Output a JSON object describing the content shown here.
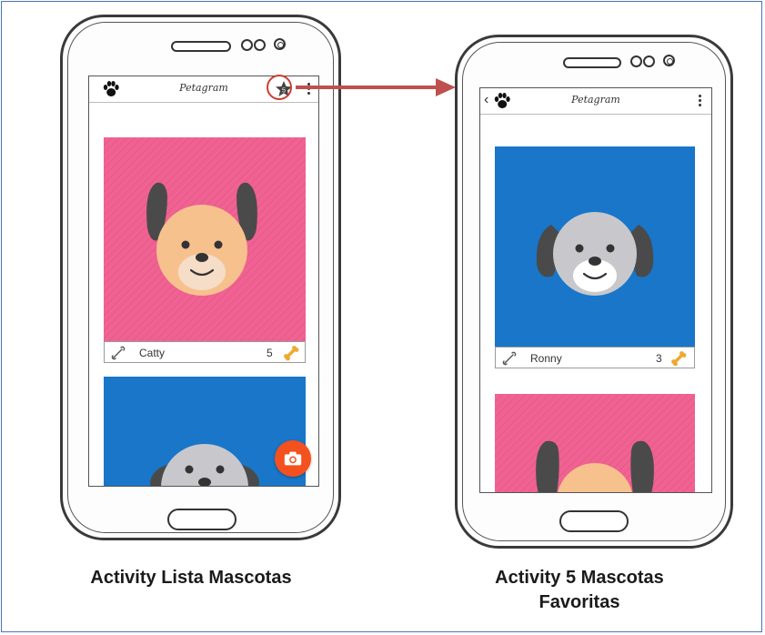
{
  "left_screen": {
    "app_title": "Petagram",
    "pets": [
      {
        "name": "Catty",
        "likes": "5",
        "bg_color": "#f06292"
      },
      {
        "name": "",
        "likes": "",
        "bg_color": "#1976c9"
      }
    ],
    "actions": {
      "favorites_icon": "star-icon",
      "fab_icon": "camera-icon"
    }
  },
  "right_screen": {
    "app_title": "Petagram",
    "back_glyph": "‹",
    "pets": [
      {
        "name": "Ronny",
        "likes": "3",
        "bg_color": "#1976c9"
      },
      {
        "name": "",
        "likes": "",
        "bg_color": "#f06292"
      }
    ]
  },
  "captions": {
    "left": "Activity Lista Mascotas",
    "right_line1": "Activity 5 Mascotas",
    "right_line2": "Favoritas"
  },
  "colors": {
    "pink": "#f06292",
    "blue": "#1976c9",
    "fab_orange": "#f4511e",
    "arrow_red": "#c0504d",
    "bone_gold": "#f0a830"
  }
}
